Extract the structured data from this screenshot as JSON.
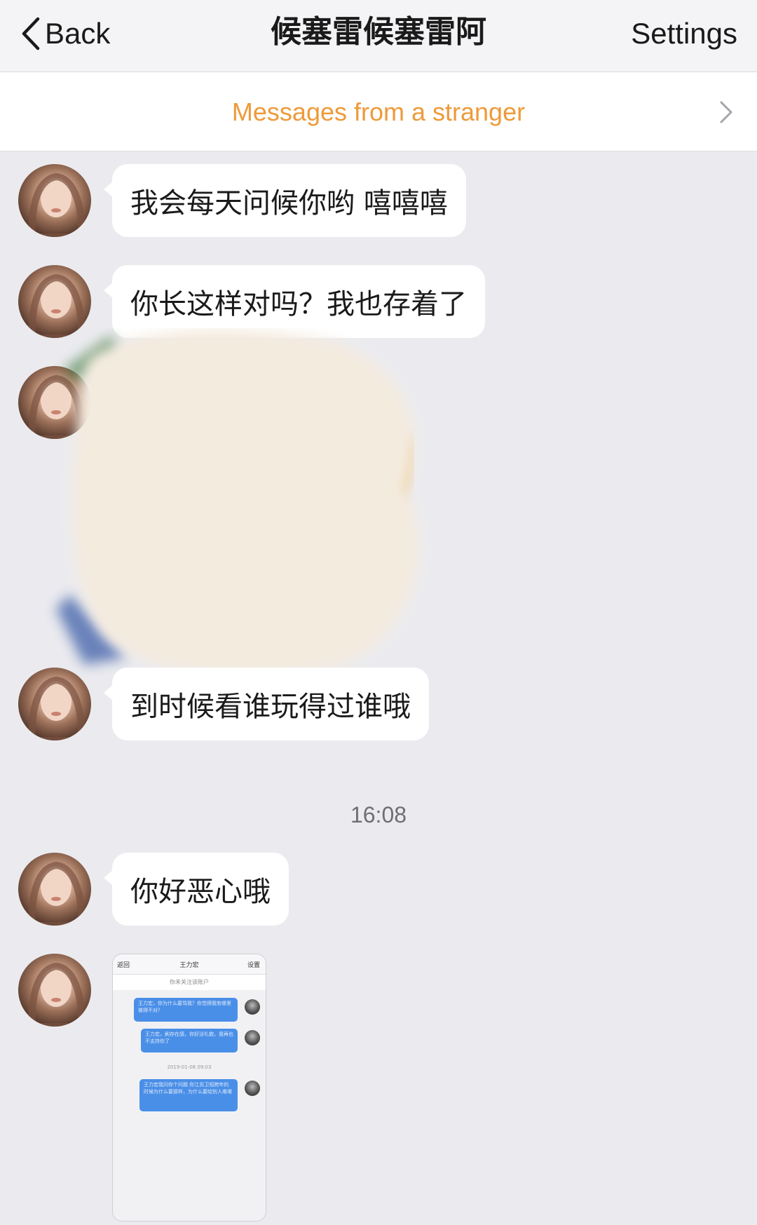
{
  "nav": {
    "back_label": "Back",
    "title": "候塞雷候塞雷阿",
    "settings_label": "Settings"
  },
  "banner": {
    "text": "Messages from a stranger",
    "color": "#ee9a3a"
  },
  "messages": [
    {
      "type": "text",
      "text": "我会每天问候你哟 嘻嘻嘻"
    },
    {
      "type": "text",
      "text": "你长这样对吗？我也存着了"
    },
    {
      "type": "image",
      "note": "blurred photo"
    },
    {
      "type": "text",
      "text": "到时候看谁玩得过谁哦"
    },
    {
      "type": "text",
      "text": "你好恶心哦"
    },
    {
      "type": "image",
      "note": "chat screenshot"
    }
  ],
  "timestamp": "16:08",
  "screenshot": {
    "back": "返回",
    "title": "王力宏",
    "settings": "设置",
    "banner": "你未关注该账户",
    "bubbles": [
      "王力宏，你为什么要骂我？你觉得我有哪里做得不对？",
      "王力宏，刷存在感，你好没礼貌，我再也不支持你了",
      "王力宏我问你个问题 你江苏卫视跨年的时候为什么要那样，为什么要给别人难堪"
    ],
    "time": "2019-01-08 09:03"
  },
  "colors": {
    "background": "#ebebef",
    "bubble": "#ffffff",
    "accent_orange": "#ee9a3a",
    "thumb_bubble": "#4a8fe7"
  },
  "icons": {
    "back": "chevron-left-icon",
    "banner": "chevron-right-icon"
  }
}
